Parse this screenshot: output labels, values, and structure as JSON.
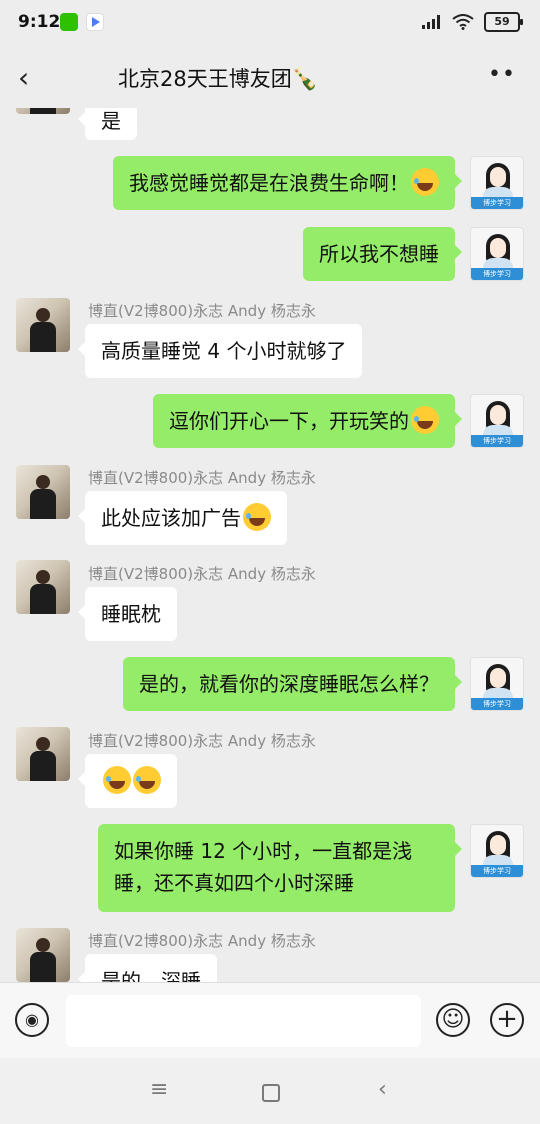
{
  "status_bar": {
    "time": "9:12",
    "battery": "59",
    "icons": [
      "wechat-app-icon",
      "play-app-icon",
      "signal-icon",
      "wifi-icon",
      "battery-icon"
    ]
  },
  "header": {
    "back_icon": "‹",
    "title": "北京28天王博友团🍾",
    "more_icon": "••"
  },
  "messages": [
    {
      "side": "in",
      "sender": "",
      "text": "是"
    },
    {
      "side": "out",
      "text": "我感觉睡觉都是在浪费生命啊！"
    },
    {
      "side": "out",
      "text": "所以我不想睡"
    },
    {
      "side": "in",
      "sender": "博直(V2博800)永志 Andy  杨志永",
      "text": "高质量睡觉 4 个小时就够了"
    },
    {
      "side": "out",
      "text": "逗你们开心一下，开玩笑的"
    },
    {
      "side": "in",
      "sender": "博直(V2博800)永志 Andy  杨志永",
      "text": "此处应该加广告"
    },
    {
      "side": "in",
      "sender": "博直(V2博800)永志 Andy  杨志永",
      "text": "睡眠枕"
    },
    {
      "side": "out",
      "text": "是的，就看你的深度睡眠怎么样？"
    },
    {
      "side": "in",
      "sender": "博直(V2博800)永志 Andy  杨志永",
      "text": ""
    },
    {
      "side": "out",
      "text": "如果你睡 12 个小时，一直都是浅睡，还不真如四个小时深睡"
    },
    {
      "side": "in",
      "sender": "博直(V2博800)永志 Andy  杨志永",
      "text": "是的，深睡"
    }
  ],
  "avatar_tag": "博步学习",
  "input": {
    "value": "",
    "placeholder": ""
  },
  "colors": {
    "bg": "#ededed",
    "outgoing_bubble": "#95ec69",
    "incoming_bubble": "#ffffff"
  }
}
